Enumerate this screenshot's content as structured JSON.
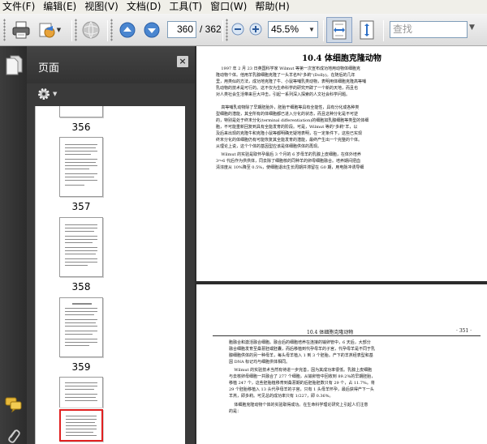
{
  "menu": {
    "items": [
      "文件(F)",
      "编辑(E)",
      "视图(V)",
      "文档(D)",
      "工具(T)",
      "窗口(W)",
      "帮助(H)"
    ]
  },
  "toolbar": {
    "current_page": "360",
    "total_pages": "/ 362",
    "zoom": "45.5%",
    "search_placeholder": "查找",
    "icons": [
      "print-icon",
      "share-icon",
      "globe-icon",
      "prev-page-icon",
      "next-page-icon",
      "zoom-out-icon",
      "zoom-in-icon",
      "fit-width-icon",
      "fit-page-icon",
      "search-dropdown-icon"
    ]
  },
  "nav_strip": {
    "icons": [
      "pages-icon",
      "comments-icon",
      "attachments-icon"
    ]
  },
  "pages_panel": {
    "title": "页面",
    "thumbnails": [
      {
        "label": "356",
        "selected": false
      },
      {
        "label": "357",
        "selected": false
      },
      {
        "label": "358",
        "selected": false
      },
      {
        "label": "359",
        "selected": false
      },
      {
        "label": "",
        "selected": true
      }
    ]
  },
  "document": {
    "page1": {
      "title": "10.4   体细胞克隆动物",
      "paragraphs": [
        "    1997 年 2 月 23 日英国科学家 Wilmut 等第一次宣布成功地用动物体细胞克\n隆动物个体。他用羊乳腺细胞克隆了一头羊名叫\"多莉\"(Dolly)。在随后的几年\n里，用类似的方法，成功地克隆了牛、小鼠等哺乳类动物，表明用体细胞克隆高等哺\n乳动物的技术是可行的。这不仅为生命科学的研究开辟了一个新的天地，而且也\n对人类社会生活带来巨大冲击，引起一系列深入探索的人文社会科学问题。",
        "    高等哺乳动物除了早期胚胎外，胚胎干细胞等具有全能性，具有分化成各种类\n型细胞的潜能，其全所有的体细胞都已进入分化的状态，而且这种分化是不可逆\n的，特别是处于终末分化(terminal differentiation)的细胞如乳腺细胞等类型的体细\n胞，不可能重新回复到具有全能发育的阶段。可是，Wilmut 等的\"多莉\"羊，以\n及后来出现的克隆牛和克隆小鼠等都明确无疑地表明，在一定条件下，这些已实现\n终末分化的体细胞仍有可能恢复其全能发育的潜能，最终产生出一个完整的个体。\n从理论上说，这个个体的基因型应该是体细胞供体的再现。",
        "    Wilmut 的实验是取怀孕最后 3 个月的 6 岁母羊的乳腺上皮细胞，在体外培养\n3～6 代后作为供供体，同去除了细胞核的同种羊的卵母细胞融合。培养期间把血\n清浓度从 10%降至 0.5%，使细胞退出生长周期并滞留在 G0 期，用电脉冲诱导细"
      ]
    },
    "page2": {
      "header_left": "10.4   体细胞克隆动物",
      "header_right": "· 351 ·",
      "paragraphs": [
        "胞融合和激活融合细胞。融合后的细胞培养在连接的输卵管中，6 天后，大部分\n融合细胞发育至桑葚胚或胚囊，而后移植到代孕母羊的子宫，代孕母羊是不同于乳\n腺细胞供体的另一种母羊，每头母羊植入 1 到 3 个胚胎。产下的羊羔经表型和基\n因 DNA 标记均与细胞供体相同。",
        "    Wilmut 的实验技术当然有待进一步完善，因为其成功率很低。乳腺上皮细胞\n与去核卵母细胞一共融合了 277 个细胞，从输卵管中回收到 89.2%的早期胚胎，\n移植 247 个，这些胚胎植移育到桑葚期的后胚胎胚数只有 29 个，占 11.7%。将\n29 个胚胎移植入 13 头代孕母羊的子宫，只有 1 头母羊怀孕，最后获得产下一头\n羊羔，即多莉。可见总的成功率只有 1/227，即 0.36%。",
        "    体细胞克隆动物个体的实验取得成功。在生命科学理论研究上引起人们注意\n的是："
      ]
    }
  }
}
